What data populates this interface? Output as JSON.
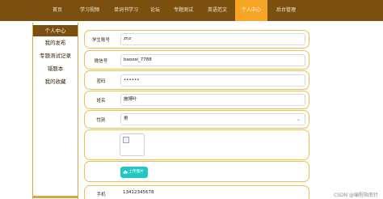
{
  "nav": {
    "items": [
      {
        "label": "首页"
      },
      {
        "label": "学习视频"
      },
      {
        "label": "单词书学习"
      },
      {
        "label": "论坛"
      },
      {
        "label": "专题测试"
      },
      {
        "label": "英语范文"
      },
      {
        "label": "个人中心",
        "active": true
      },
      {
        "label": "后台管理"
      }
    ]
  },
  "sidebar": {
    "header": "个人中心",
    "items": [
      {
        "label": "我的发布"
      },
      {
        "label": "专题测试记录"
      },
      {
        "label": "错题本"
      },
      {
        "label": "我的收藏"
      }
    ]
  },
  "form": {
    "student_no": {
      "label": "学生账号",
      "value": "znz"
    },
    "wechat": {
      "label": "微信号",
      "value": "baozai_7788"
    },
    "password": {
      "label": "密码",
      "value": "••••••"
    },
    "name": {
      "label": "姓名",
      "value": "施博叶"
    },
    "gender": {
      "label": "性别",
      "value": "男"
    },
    "upload_label": "上传图片",
    "phone": {
      "label": "手机",
      "value": "13412345678"
    }
  },
  "watermark": "CSDN @编程指南针",
  "colors": {
    "nav_bg": "#7b4f10",
    "nav_active": "#f6a524",
    "border": "#f0bf52",
    "upload_btn": "#22c7c2"
  },
  "icons": {
    "upload": "cloud-upload-icon",
    "select": "chevron-down-icon"
  }
}
